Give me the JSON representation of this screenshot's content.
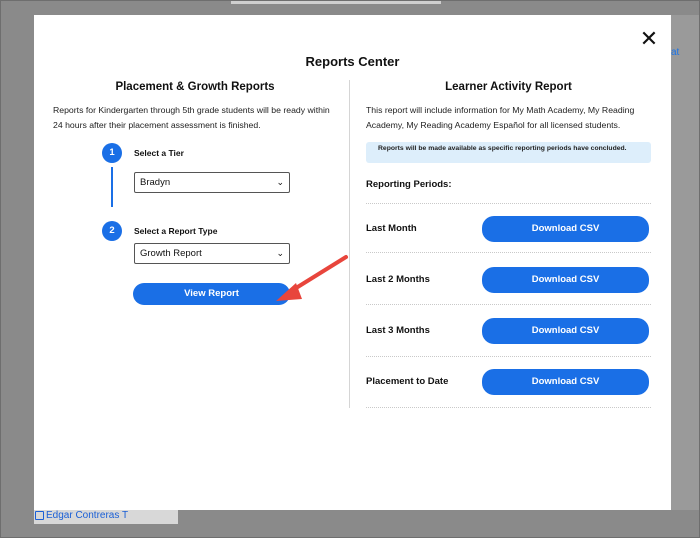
{
  "background": {
    "right_link": "at",
    "bottom_link": "Edgar Contreras T"
  },
  "modal": {
    "title": "Reports Center",
    "close_glyph": "✕"
  },
  "left": {
    "heading": "Placement & Growth Reports",
    "description": "Reports for Kindergarten through 5th grade students will be ready within 24 hours after their placement assessment is finished.",
    "steps": [
      {
        "number": "1",
        "label": "Select a Tier",
        "selected": "Bradyn"
      },
      {
        "number": "2",
        "label": "Select a Report Type",
        "selected": "Growth Report"
      }
    ],
    "view_button": "View Report"
  },
  "right": {
    "heading": "Learner Activity Report",
    "description": "This report will include information for My Math Academy, My Reading Academy, My Reading Academy Español for all licensed students.",
    "notice": "Reports will be made available as specific reporting periods have concluded.",
    "periods_label": "Reporting Periods:",
    "periods": [
      {
        "name": "Last Month",
        "button": "Download CSV"
      },
      {
        "name": "Last 2 Months",
        "button": "Download CSV"
      },
      {
        "name": "Last 3 Months",
        "button": "Download CSV"
      },
      {
        "name": "Placement to Date",
        "button": "Download CSV"
      }
    ]
  },
  "colors": {
    "accent": "#1a6fe6",
    "annotation_arrow": "#e8453c",
    "notice_bg": "#ddeefb"
  }
}
